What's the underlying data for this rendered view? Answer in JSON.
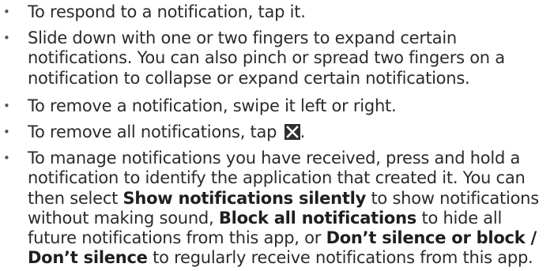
{
  "bullet_glyph": "•",
  "items": [
    {
      "text": "To respond to a notification, tap it."
    },
    {
      "text": "Slide down with one or two fingers to expand certain notifications. You can also pinch or spread two fingers on a notification to collapse or expand certain notifications."
    },
    {
      "text": "To remove a notification, swipe it left or right."
    },
    {
      "before": "To remove all notifications, tap",
      "icon": "close-all-icon",
      "after": "."
    },
    {
      "part1": "To manage notifications you have received, press and hold a notification to identify the application that created it. You can then select ",
      "bold1": "Show notifications silently",
      "part2": " to show notifications without making sound, ",
      "bold2": "Block all notifications",
      "part3": " to hide all future notifications from this app, or ",
      "bold3": "Don’t silence or block / Don’t silence",
      "part4": " to regularly receive notifications from this app."
    }
  ]
}
